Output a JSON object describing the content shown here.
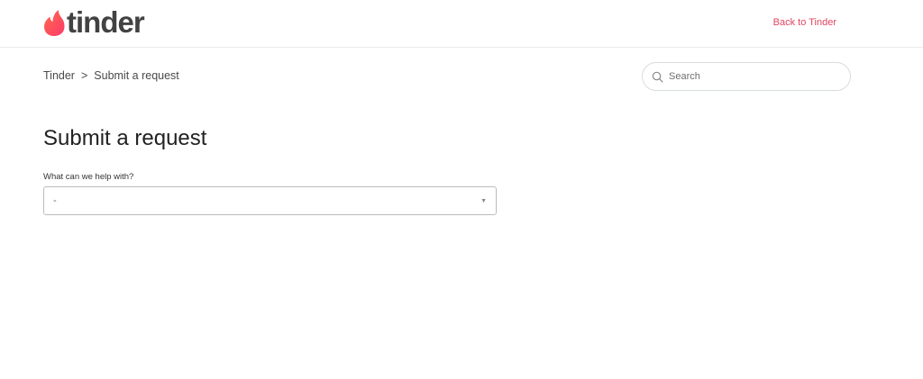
{
  "header": {
    "logo_text": "tinder",
    "back_link": "Back to Tinder"
  },
  "breadcrumb": {
    "home": "Tinder",
    "separator": ">",
    "current": "Submit a request"
  },
  "search": {
    "placeholder": "Search"
  },
  "main": {
    "title": "Submit a request",
    "field_label": "What can we help with?",
    "select_value": "-"
  },
  "colors": {
    "brand": "#fd5068",
    "link": "#e0455f"
  },
  "icons": {
    "logo": "flame-icon",
    "search": "search-icon",
    "select": "caret-down-icon"
  }
}
